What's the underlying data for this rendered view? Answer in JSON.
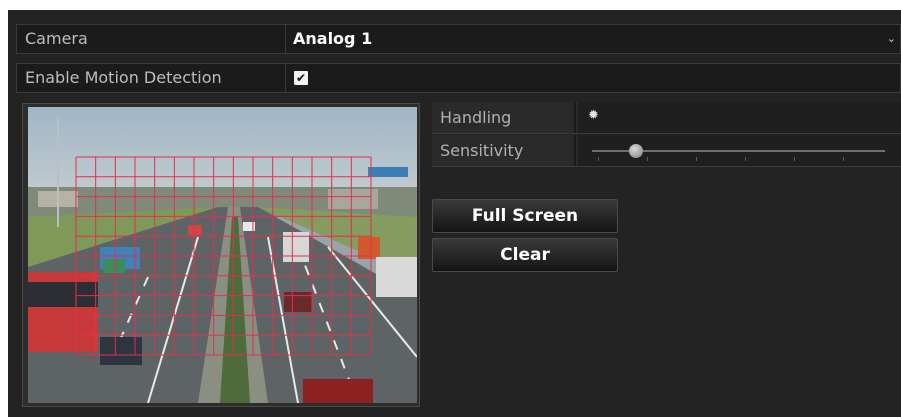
{
  "camera": {
    "label": "Camera",
    "value": "Analog 1",
    "dropdown_icon": "chevron-down-icon"
  },
  "motion": {
    "label": "Enable Motion Detection",
    "checked": true,
    "check_mark": "✔"
  },
  "settings": {
    "handling_label": "Handling",
    "handling_icon": "gear-icon",
    "sensitivity_label": "Sensitivity",
    "sensitivity_level": 0.15
  },
  "buttons": {
    "full_screen": "Full Screen",
    "clear": "Clear"
  },
  "preview": {
    "grid_color": "#e0304f",
    "grid_cols": 15,
    "grid_rows": 10
  }
}
